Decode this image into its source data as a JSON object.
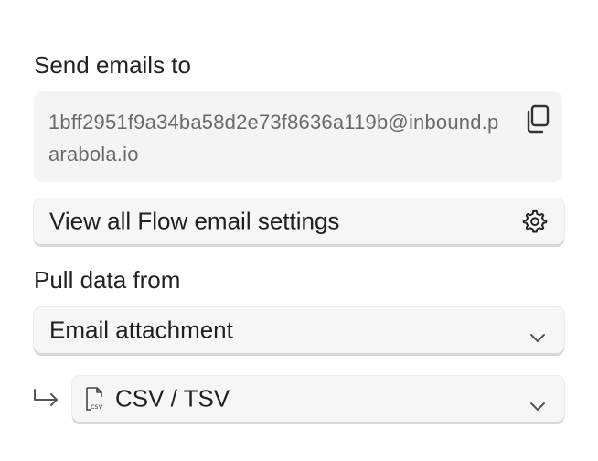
{
  "send_section": {
    "label": "Send emails to",
    "email_address": "1bff2951f9a34ba58d2e73f8636a119b@inbound.parabola.io"
  },
  "settings_button": {
    "label": "View all Flow email settings"
  },
  "pull_section": {
    "label": "Pull data from",
    "selected": "Email attachment"
  },
  "format_select": {
    "selected": "CSV / TSV"
  },
  "icons": {
    "copy": "copy-icon",
    "gear": "gear-icon",
    "chevron": "chevron-down-icon",
    "sub_arrow": "return-arrow-icon",
    "csv_file": "csv-file-icon"
  }
}
